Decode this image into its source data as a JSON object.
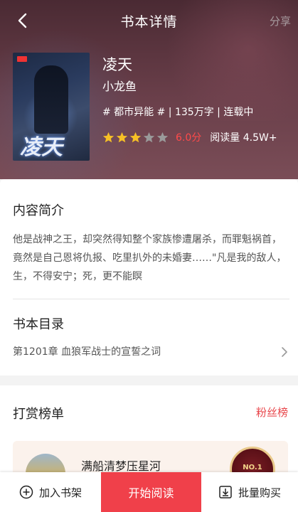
{
  "header": {
    "title": "书本详情",
    "share_label": "分享"
  },
  "book": {
    "cover_title": "凌天",
    "title": "凌天",
    "author": "小龙鱼",
    "meta": "# 都市异能 # | 135万字 | 连载中",
    "rating_stars": 3,
    "rating_max": 5,
    "score": "6.0分",
    "read_count": "阅读量 4.5W+"
  },
  "intro": {
    "section_title": "内容简介",
    "text": "他是战神之王，却突然得知整个家族惨遭屠杀，而罪魁祸首，竟然是自己恩将仇报、吃里扒外的未婚妻……\"凡是我的敌人，生，不得安宁；死，更不能瞑"
  },
  "toc": {
    "section_title": "书本目录",
    "latest_chapter": "第1201章 血狼军战士的宣誓之词"
  },
  "ranking": {
    "section_title": "打赏榜单",
    "fans_link": "粉丝榜",
    "top_fan_name": "满船清梦压星河",
    "medal_label": "NO.1"
  },
  "bottom_bar": {
    "add_shelf": "加入书架",
    "start_read": "开始阅读",
    "batch_buy": "批量购买"
  },
  "colors": {
    "accent": "#f0404a",
    "score": "#ff4a4a",
    "star_on": "#f6c026",
    "star_off": "#9a9a9a"
  }
}
